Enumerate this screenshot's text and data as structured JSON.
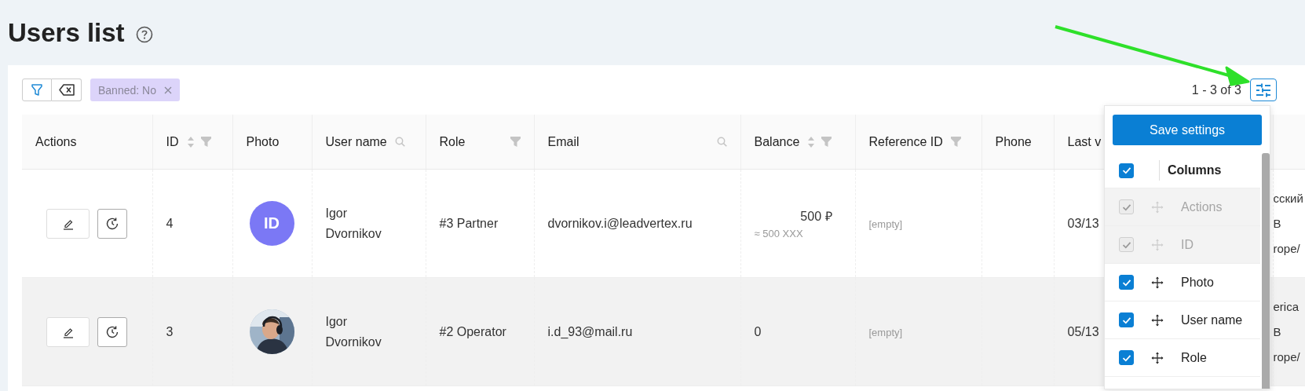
{
  "page": {
    "title": "Users list"
  },
  "toolbar": {
    "filter_tags": [
      {
        "label": "Banned: No"
      }
    ],
    "pagination": "1 - 3 of 3"
  },
  "table": {
    "columns": [
      {
        "label": "Actions",
        "sortable": false,
        "filterable": false,
        "searchable": false
      },
      {
        "label": "ID",
        "sortable": true,
        "filterable": true,
        "searchable": false
      },
      {
        "label": "Photo",
        "sortable": false,
        "filterable": false,
        "searchable": false
      },
      {
        "label": "User name",
        "sortable": false,
        "filterable": false,
        "searchable": true
      },
      {
        "label": "Role",
        "sortable": false,
        "filterable": true,
        "searchable": false
      },
      {
        "label": "Email",
        "sortable": false,
        "filterable": false,
        "searchable": true
      },
      {
        "label": "Balance",
        "sortable": true,
        "filterable": true,
        "searchable": false
      },
      {
        "label": "Reference ID",
        "sortable": false,
        "filterable": true,
        "searchable": false
      },
      {
        "label": "Phone",
        "sortable": false,
        "filterable": false,
        "searchable": false
      },
      {
        "label": "Last v"
      }
    ],
    "rows": [
      {
        "hovered": false,
        "id": "4",
        "avatar": {
          "kind": "initials",
          "text": "ID",
          "color": "#7b78f5"
        },
        "user_name": "Igor Dvornikov",
        "role": "#3 Partner",
        "email": "dvornikov.i@leadvertex.ru",
        "balance": "500 ₽",
        "balance_note": "≈ 500 XXX",
        "reference_id": "[empty]",
        "last_visit": "03/13",
        "column_11": [
          "сский",
          "B",
          "rope/"
        ]
      },
      {
        "hovered": true,
        "id": "3",
        "user_name": "Igor Dvornikov",
        "role": "#2 Operator",
        "email": "i.d_93@mail.ru",
        "balance": "0",
        "reference_id": "[empty]",
        "last_visit": "05/13",
        "column_11": [
          "erica",
          "B",
          "rope/"
        ]
      }
    ]
  },
  "column_settings": {
    "save_button": "Save settings",
    "header": {
      "label": "Columns",
      "checked": true
    },
    "items": [
      {
        "label": "Actions",
        "checked": true,
        "disabled": true
      },
      {
        "label": "ID",
        "checked": true,
        "disabled": true
      },
      {
        "label": "Photo",
        "checked": true,
        "disabled": false
      },
      {
        "label": "User name",
        "checked": true,
        "disabled": false
      },
      {
        "label": "Role",
        "checked": true,
        "disabled": false
      }
    ]
  }
}
